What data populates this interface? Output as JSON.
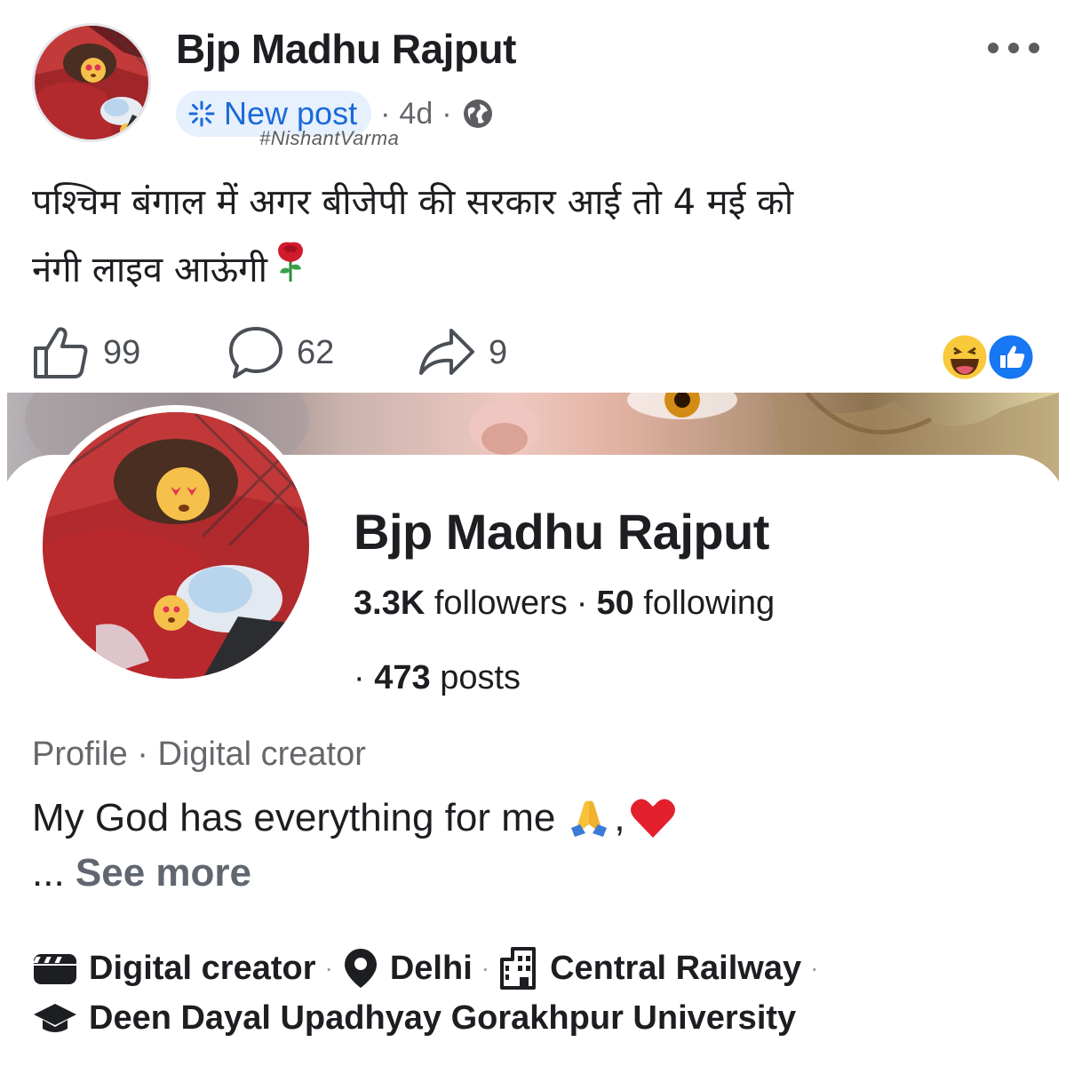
{
  "post": {
    "author_name": "Bjp Madhu Rajput",
    "new_post_label": "New post",
    "time_ago": "4d",
    "separator": "·",
    "watermark": "#NishantVarma",
    "text_line1": "पश्चिम बंगाल में अगर बीजेपी की सरकार आई तो 4 मई को",
    "text_line2": "नंगी लाइव आऊंगी",
    "likes": "99",
    "comments": "62",
    "shares": "9",
    "icons": {
      "more": "more-options-icon",
      "new_post": "sparkle-icon",
      "privacy": "globe-icon",
      "rose": "rose-emoji",
      "like": "thumbs-up-icon",
      "comment": "comment-icon",
      "share": "share-icon",
      "reactions": [
        "haha-reaction",
        "like-reaction"
      ]
    }
  },
  "profile": {
    "name": "Bjp Madhu Rajput",
    "followers_count": "3.3K",
    "followers_label": "followers",
    "following_count": "50",
    "following_label": "following",
    "posts_prefix": "·",
    "posts_count": "473",
    "posts_label": "posts",
    "category": "Profile · Digital creator",
    "bio": "My God has everything for me",
    "bio_emoji_suffix": ",",
    "see_more_prefix": "...",
    "see_more_label": "See more",
    "details_row1": [
      {
        "icon": "clapperboard-icon",
        "label": "Digital creator"
      },
      {
        "icon": "location-pin-icon",
        "label": "Delhi"
      },
      {
        "icon": "building-icon",
        "label": "Central Railway"
      }
    ],
    "details_row2": [
      {
        "icon": "graduation-cap-icon",
        "label": "Deen Dayal Upadhyay Gorakhpur University"
      }
    ]
  },
  "colors": {
    "accent_blue": "#1a6ad8",
    "pill_bg": "#e7f0fd",
    "text_primary": "#1c1e21",
    "text_secondary": "#65676b"
  }
}
